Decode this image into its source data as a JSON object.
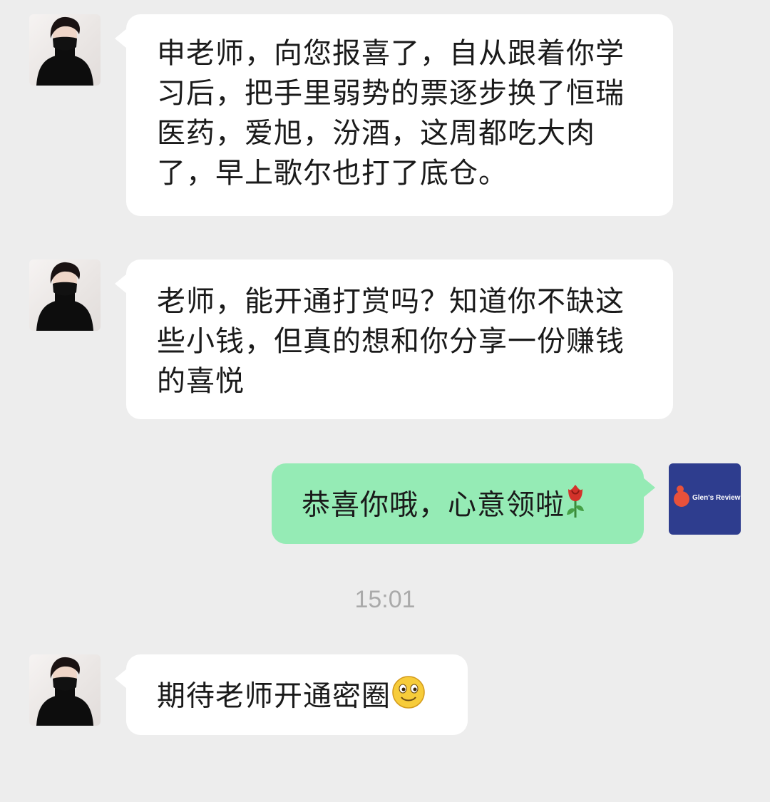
{
  "messages": [
    {
      "sender": "contact",
      "text": "申老师，向您报喜了，自从跟着你学习后，把手里弱势的票逐步换了恒瑞医药，爱旭，汾酒，这周都吃大肉了，早上歌尔也打了底仓。"
    },
    {
      "sender": "contact",
      "text": "老师，能开通打赏吗？知道你不缺这些小钱，但真的想和你分享一份赚钱的喜悦"
    },
    {
      "sender": "self",
      "text": "恭喜你哦，心意领啦",
      "emoji": "rose-emoji"
    },
    {
      "sender": "contact",
      "text": "期待老师开通密圈",
      "emoji": "smile-emoji"
    }
  ],
  "timestamp": "15:01",
  "self_avatar": {
    "label": "Glen's Review"
  },
  "colors": {
    "background": "#ededed",
    "incoming_bubble": "#ffffff",
    "outgoing_bubble": "#95ebb5",
    "self_avatar_bg": "#2e3d8e",
    "brand_accent": "#e8513a"
  }
}
